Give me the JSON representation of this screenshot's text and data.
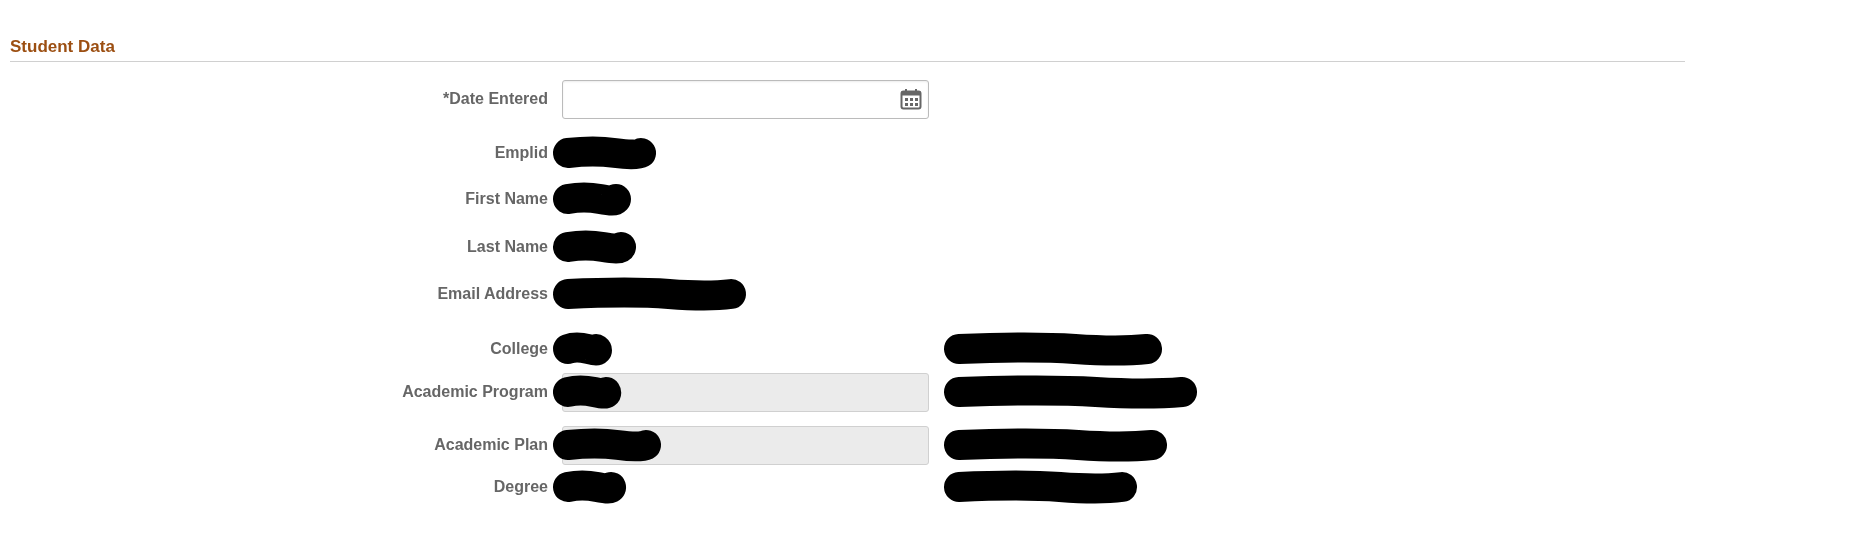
{
  "section": {
    "title": "Student Data"
  },
  "fields": [
    {
      "label": "*Date Entered",
      "kind": "date"
    },
    {
      "label": "Emplid",
      "kind": "display",
      "value_redacted": true
    },
    {
      "label": "First Name",
      "kind": "display",
      "value_redacted": true
    },
    {
      "label": "Last Name",
      "kind": "display",
      "value_redacted": true
    },
    {
      "label": "Email Address",
      "kind": "display",
      "value_redacted": true
    },
    {
      "label": "College",
      "kind": "display",
      "value_redacted": true,
      "description_redacted": true
    },
    {
      "label": "Academic Program",
      "kind": "readonly",
      "value_redacted": true,
      "description_redacted": true
    },
    {
      "label": "Academic Plan",
      "kind": "readonly",
      "value_redacted": true,
      "description_redacted": true
    },
    {
      "label": "Degree",
      "kind": "display",
      "value_redacted": true,
      "description_redacted": true
    }
  ]
}
